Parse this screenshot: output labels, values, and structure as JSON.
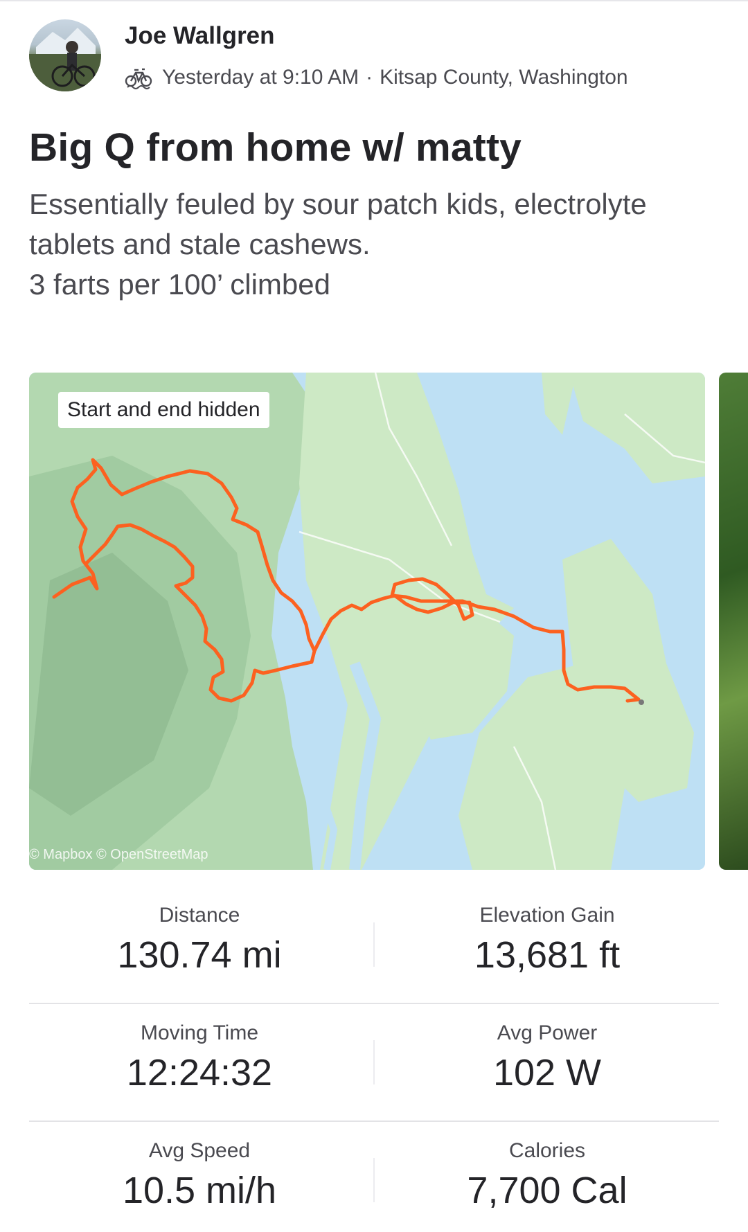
{
  "athlete": {
    "name": "Joe Wallgren",
    "activity_icon": "bike-icon",
    "time": "Yesterday at 9:10 AM",
    "separator": "·",
    "location": "Kitsap County, Washington"
  },
  "activity": {
    "title": "Big Q from home w/ matty",
    "description_lines": [
      "Essentially feuled by sour patch kids, electrolyte",
      "tablets and stale cashews.",
      "3 farts per 100’ climbed"
    ]
  },
  "map": {
    "badge": "Start and end hidden",
    "attribution": "© Mapbox © OpenStreetMap",
    "route_color": "#fc4c02"
  },
  "stats": [
    {
      "label": "Distance",
      "value": "130.74 mi"
    },
    {
      "label": "Elevation Gain",
      "value": "13,681 ft"
    },
    {
      "label": "Moving Time",
      "value": "12:24:32"
    },
    {
      "label": "Avg Power",
      "value": "102 W"
    },
    {
      "label": "Avg Speed",
      "value": "10.5 mi/h"
    },
    {
      "label": "Calories",
      "value": "7,700 Cal"
    }
  ]
}
